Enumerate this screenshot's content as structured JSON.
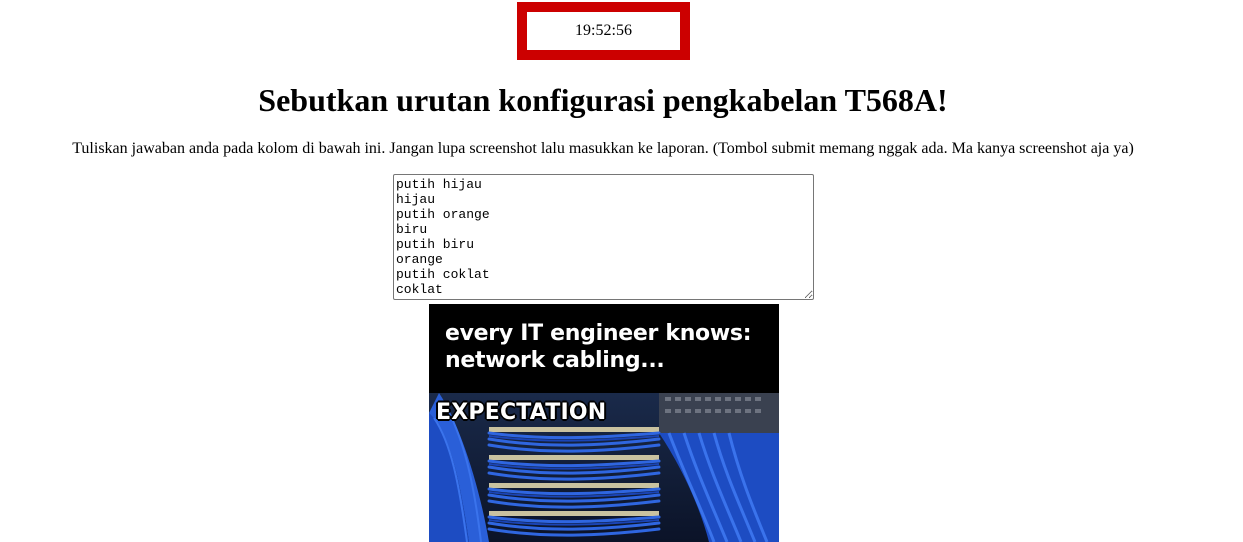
{
  "clock": {
    "time": "19:52:56",
    "border_color": "#cc0000"
  },
  "question": {
    "title": "Sebutkan urutan konfigurasi pengkabelan T568A!",
    "instruction": "Tuliskan jawaban anda pada kolom di bawah ini. Jangan lupa screenshot lalu masukkan ke laporan. (Tombol submit memang nggak ada. Ma kanya screenshot aja ya)"
  },
  "answer": {
    "value": "putih hijau\nhijau\nputih orange\nbiru\nputih biru\norange\nputih coklat\ncoklat"
  },
  "meme": {
    "caption": "every IT engineer knows: network cabling...",
    "label": "EXPECTATION",
    "cable_color": "#1f4fbf"
  }
}
